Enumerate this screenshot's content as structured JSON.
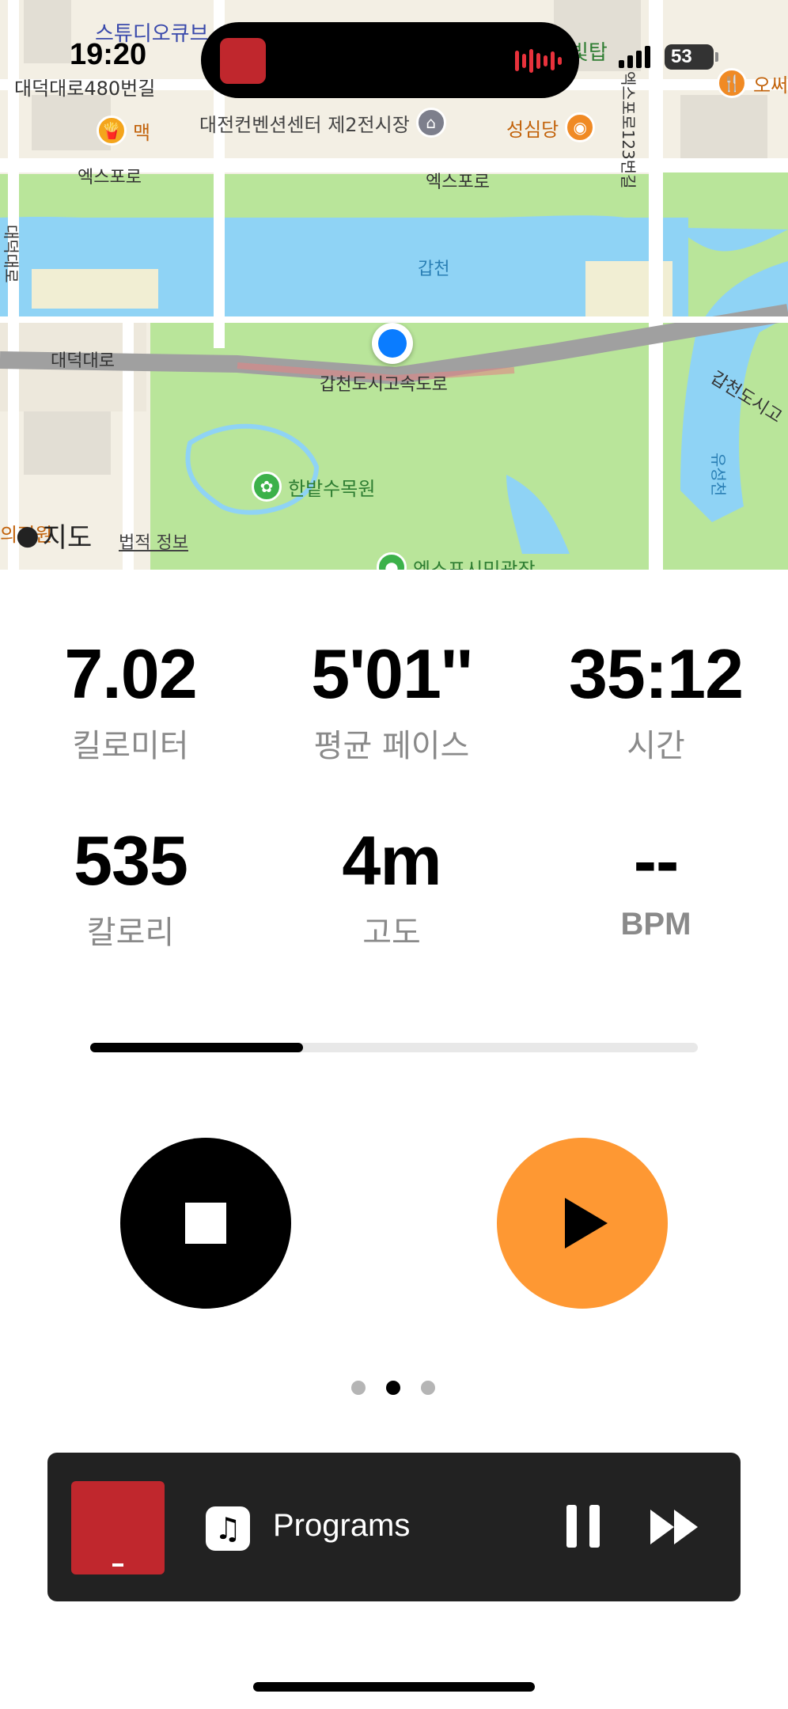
{
  "status_bar": {
    "time": "19:20",
    "battery": "53"
  },
  "map": {
    "labels": {
      "poi_studio_cube": "스튜디오큐브",
      "road_daedeok_480": "대덕대로480번길",
      "poi_mac": "맥",
      "poi_convention": "대전컨벤션센터 제2전시장",
      "poi_sungsimdang": "성심당",
      "poi_bittap": "빛탑",
      "poi_oser": "오써",
      "road_expo_left": "엑스포로",
      "road_expo_mid": "엑스포로",
      "road_expo_123": "엑스포로123번길",
      "road_daedeok_vertical": "대덕대로",
      "river_gapcheon": "갑천",
      "road_daedeok": "대덕대로",
      "highway": "갑천도시고속도로",
      "highway_right": "갑천도시고",
      "poi_arboretum": "한밭수목원",
      "stream_yuseong": "유성천",
      "poi_uijeongwon": "의정원",
      "poi_expo_plaza": "엑스포시민광장"
    },
    "brand": "지도",
    "legal": "법적 정보"
  },
  "metrics": [
    {
      "value": "7.02",
      "label": "킬로미터"
    },
    {
      "value": "5'01''",
      "label": "평균 페이스"
    },
    {
      "value": "35:12",
      "label": "시간"
    },
    {
      "value": "535",
      "label": "칼로리"
    },
    {
      "value": "4m",
      "label": "고도"
    },
    {
      "value": "--",
      "label": "BPM"
    }
  ],
  "progress": 0.35,
  "pager": {
    "count": 3,
    "active": 1
  },
  "player": {
    "title": "Programs",
    "app_icon": "music-note-icon"
  },
  "colors": {
    "accent_orange": "#fe9833",
    "location_blue": "#0a7cff",
    "player_bg": "#222222"
  }
}
